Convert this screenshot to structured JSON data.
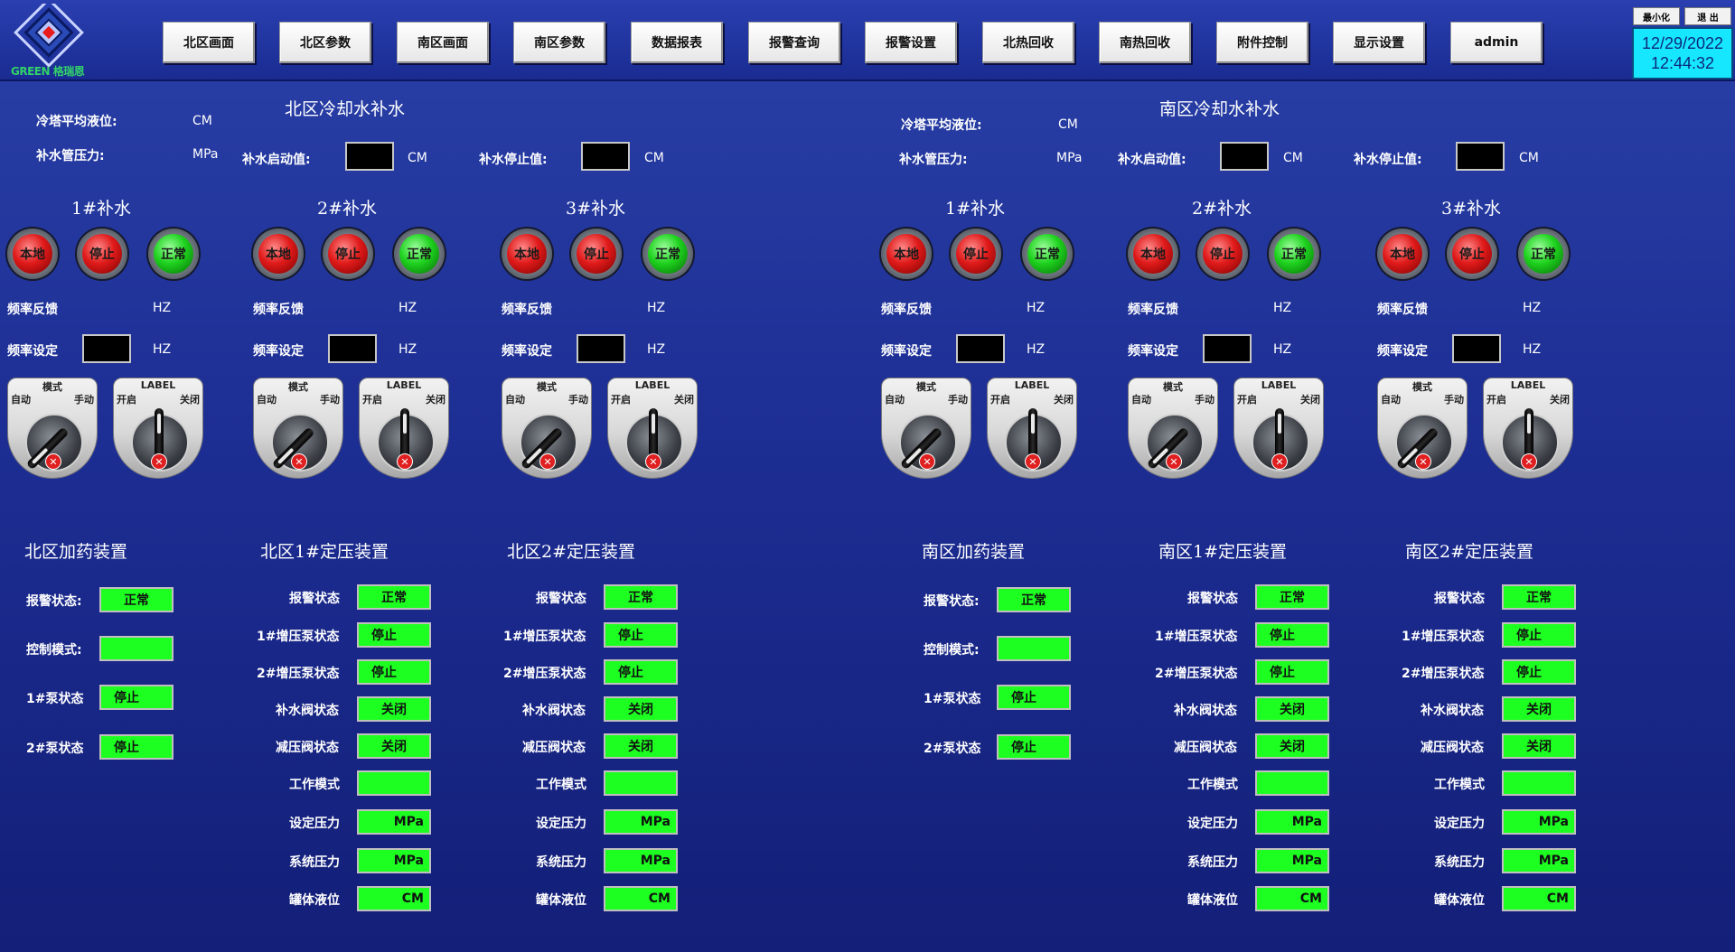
{
  "header": {
    "logo_text": "GREEN 格瑞恩",
    "nav": [
      "北区画面",
      "北区参数",
      "南区画面",
      "南区参数",
      "数据报表",
      "报警查询",
      "报警设置",
      "北热回收",
      "南热回收",
      "附件控制",
      "显示设置",
      "admin"
    ],
    "minimize_label": "最小化",
    "exit_label": "退 出",
    "date": "12/29/2022",
    "time": "12:44:32"
  },
  "colors": {
    "background": "#1d2e94",
    "status_green": "#1dff21",
    "clock_bg": "#17e6ff",
    "lamp_red": "#e01a1a",
    "lamp_green": "#1ed21e"
  },
  "north": {
    "title": "北区冷却水补水",
    "avg_level_label": "冷塔平均液位:",
    "avg_level_unit": "CM",
    "pipe_pressure_label": "补水管压力:",
    "pipe_pressure_unit": "MPa",
    "start_label": "补水启动值:",
    "start_unit": "CM",
    "stop_label": "补水停止值:",
    "stop_unit": "CM"
  },
  "south": {
    "title": "南区冷却水补水",
    "avg_level_label": "冷塔平均液位:",
    "avg_level_unit": "CM",
    "pipe_pressure_label": "补水管压力:",
    "pipe_pressure_unit": "MPa",
    "start_label": "补水启动值:",
    "start_unit": "CM",
    "stop_label": "补水停止值:",
    "stop_unit": "CM"
  },
  "pumps": {
    "titles": [
      "1#补水",
      "2#补水",
      "3#补水"
    ],
    "lamp_local": "本地",
    "lamp_stop": "停止",
    "lamp_normal": "正常",
    "freq_feedback_label": "频率反馈",
    "freq_set_label": "频率设定",
    "freq_unit": "HZ",
    "mode_switch": {
      "title": "模式",
      "left": "自动",
      "right": "手动"
    },
    "valve_switch": {
      "title": "LABEL",
      "left": "开启",
      "right": "关闭"
    }
  },
  "dosing": {
    "north_title": "北区加药装置",
    "south_title": "南区加药装置",
    "alarm_label": "报警状态:",
    "alarm_value": "正常",
    "control_label": "控制模式:",
    "control_value": "",
    "pump1_label": "1#泵状态",
    "pump1_value": "停止",
    "pump2_label": "2#泵状态",
    "pump2_value": "停止"
  },
  "pressure": {
    "north1_title": "北区1#定压装置",
    "north2_title": "北区2#定压装置",
    "south1_title": "南区1#定压装置",
    "south2_title": "南区2#定压装置",
    "alarm_label": "报警状态",
    "alarm_value": "正常",
    "boost1_label": "1#增压泵状态",
    "boost1_value": "停止",
    "boost2_label": "2#增压泵状态",
    "boost2_value": "停止",
    "fill_valve_label": "补水阀状态",
    "fill_valve_value": "关闭",
    "relief_valve_label": "减压阀状态",
    "relief_valve_value": "关闭",
    "work_mode_label": "工作模式",
    "work_mode_value": "",
    "set_pressure_label": "设定压力",
    "set_pressure_unit": "MPa",
    "sys_pressure_label": "系统压力",
    "sys_pressure_unit": "MPa",
    "tank_level_label": "罐体液位",
    "tank_level_unit": "CM"
  }
}
